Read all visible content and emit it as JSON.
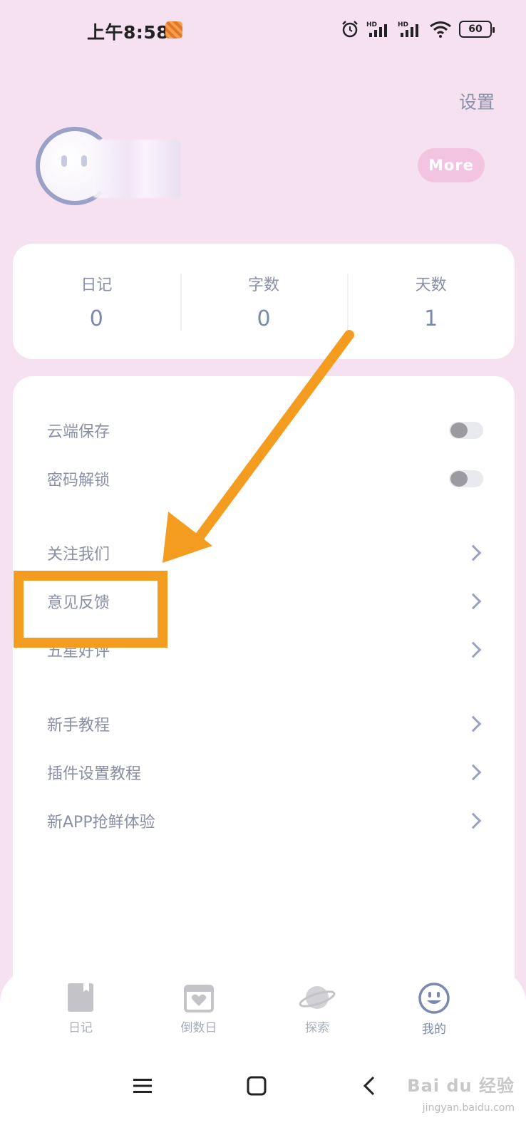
{
  "status_bar": {
    "time": "上午8:58",
    "battery": "60"
  },
  "header": {
    "settings_label": "设置",
    "more_label": "More"
  },
  "stats": [
    {
      "label": "日记",
      "value": "0"
    },
    {
      "label": "字数",
      "value": "0"
    },
    {
      "label": "天数",
      "value": "1"
    }
  ],
  "menu": {
    "toggles": [
      {
        "label": "云端保存",
        "on": false
      },
      {
        "label": "密码解锁",
        "on": false
      }
    ],
    "group1": [
      "关注我们",
      "意见反馈",
      "五星好评"
    ],
    "group2": [
      "新手教程",
      "插件设置教程",
      "新APP抢鲜体验"
    ]
  },
  "tabs": [
    {
      "label": "日记",
      "icon": "diary-icon"
    },
    {
      "label": "倒数日",
      "icon": "calendar-heart-icon"
    },
    {
      "label": "探索",
      "icon": "planet-icon"
    },
    {
      "label": "我的",
      "icon": "smiley-face-icon"
    }
  ],
  "watermark": {
    "brand": "Bai du 经验",
    "url": "jingyan.baidu.com"
  },
  "colors": {
    "background": "#f6e1f1",
    "accent": "#7b88b0",
    "annotation": "#f39c1f",
    "more_button": "#f2c4e1"
  }
}
